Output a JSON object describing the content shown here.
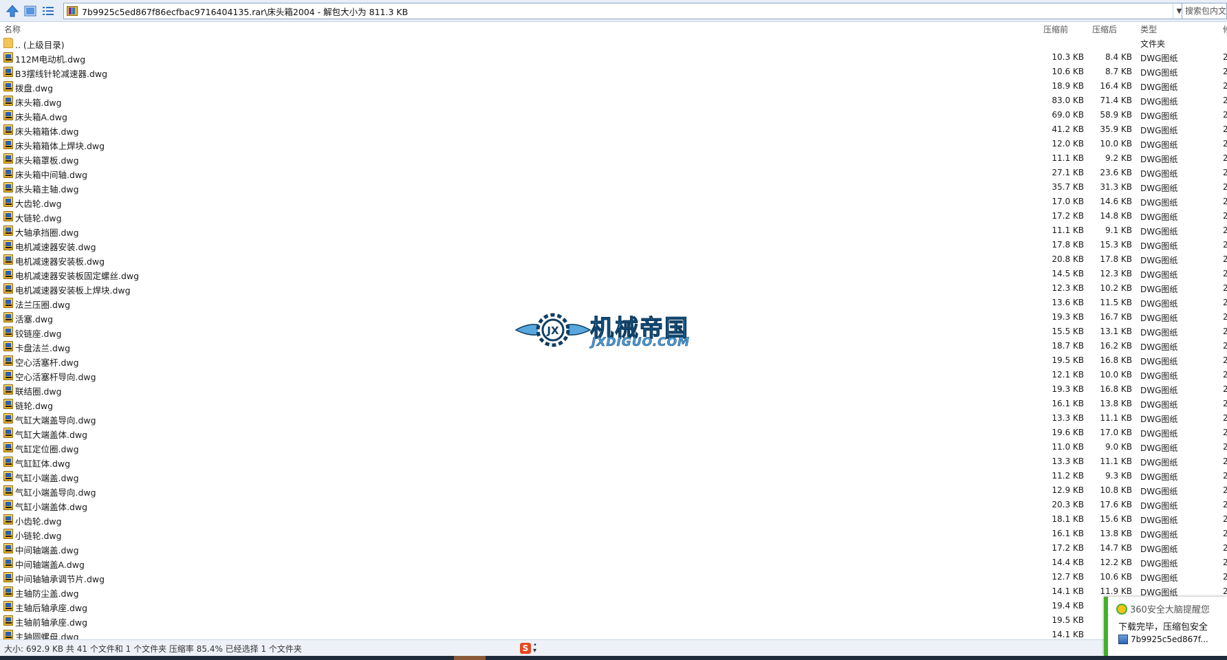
{
  "toolbar": {
    "up_icon": "up-arrow-icon",
    "view_icon": "panel-view-icon",
    "details_icon": "details-list-icon"
  },
  "address": {
    "path": "7b9925c5ed867f86ecfbac9716404135.rar\\床头箱2004 - 解包大小为 811.3 KB"
  },
  "search": {
    "placeholder": "搜索包内文件"
  },
  "columns": {
    "name": "名称",
    "packed": "压缩前",
    "unpacked": "压缩后",
    "type": "类型",
    "extra": "修"
  },
  "parent_folder": {
    "name": ".. (上级目录)",
    "type": "文件夹"
  },
  "files": [
    {
      "name": "112M电动机.dwg",
      "before": "10.3 KB",
      "after": "8.4 KB",
      "type": "DWG图纸",
      "extra": "2"
    },
    {
      "name": "B3摆线针轮减速器.dwg",
      "before": "10.6 KB",
      "after": "8.7 KB",
      "type": "DWG图纸",
      "extra": "2"
    },
    {
      "name": "拨盘.dwg",
      "before": "18.9 KB",
      "after": "16.4 KB",
      "type": "DWG图纸",
      "extra": "2"
    },
    {
      "name": "床头箱.dwg",
      "before": "83.0 KB",
      "after": "71.4 KB",
      "type": "DWG图纸",
      "extra": "2"
    },
    {
      "name": "床头箱A.dwg",
      "before": "69.0 KB",
      "after": "58.9 KB",
      "type": "DWG图纸",
      "extra": "2"
    },
    {
      "name": "床头箱箱体.dwg",
      "before": "41.2 KB",
      "after": "35.9 KB",
      "type": "DWG图纸",
      "extra": "2"
    },
    {
      "name": "床头箱箱体上焊块.dwg",
      "before": "12.0 KB",
      "after": "10.0 KB",
      "type": "DWG图纸",
      "extra": "2"
    },
    {
      "name": "床头箱罩板.dwg",
      "before": "11.1 KB",
      "after": "9.2 KB",
      "type": "DWG图纸",
      "extra": "2"
    },
    {
      "name": "床头箱中间轴.dwg",
      "before": "27.1 KB",
      "after": "23.6 KB",
      "type": "DWG图纸",
      "extra": "2"
    },
    {
      "name": "床头箱主轴.dwg",
      "before": "35.7 KB",
      "after": "31.3 KB",
      "type": "DWG图纸",
      "extra": "2"
    },
    {
      "name": "大齿轮.dwg",
      "before": "17.0 KB",
      "after": "14.6 KB",
      "type": "DWG图纸",
      "extra": "2"
    },
    {
      "name": "大链轮.dwg",
      "before": "17.2 KB",
      "after": "14.8 KB",
      "type": "DWG图纸",
      "extra": "2"
    },
    {
      "name": "大轴承挡圈.dwg",
      "before": "11.1 KB",
      "after": "9.1 KB",
      "type": "DWG图纸",
      "extra": "2"
    },
    {
      "name": "电机减速器安装.dwg",
      "before": "17.8 KB",
      "after": "15.3 KB",
      "type": "DWG图纸",
      "extra": "2"
    },
    {
      "name": "电机减速器安装板.dwg",
      "before": "20.8 KB",
      "after": "17.8 KB",
      "type": "DWG图纸",
      "extra": "2"
    },
    {
      "name": "电机减速器安装板固定螺丝.dwg",
      "before": "14.5 KB",
      "after": "12.3 KB",
      "type": "DWG图纸",
      "extra": "2"
    },
    {
      "name": "电机减速器安装板上焊块.dwg",
      "before": "12.3 KB",
      "after": "10.2 KB",
      "type": "DWG图纸",
      "extra": "2"
    },
    {
      "name": "法兰压圈.dwg",
      "before": "13.6 KB",
      "after": "11.5 KB",
      "type": "DWG图纸",
      "extra": "2"
    },
    {
      "name": "活塞.dwg",
      "before": "19.3 KB",
      "after": "16.7 KB",
      "type": "DWG图纸",
      "extra": "2"
    },
    {
      "name": "铰链座.dwg",
      "before": "15.5 KB",
      "after": "13.1 KB",
      "type": "DWG图纸",
      "extra": "2"
    },
    {
      "name": "卡盘法兰.dwg",
      "before": "18.7 KB",
      "after": "16.2 KB",
      "type": "DWG图纸",
      "extra": "2"
    },
    {
      "name": "空心活塞杆.dwg",
      "before": "19.5 KB",
      "after": "16.8 KB",
      "type": "DWG图纸",
      "extra": "2"
    },
    {
      "name": "空心活塞杆导向.dwg",
      "before": "12.1 KB",
      "after": "10.0 KB",
      "type": "DWG图纸",
      "extra": "2"
    },
    {
      "name": "联结圈.dwg",
      "before": "19.3 KB",
      "after": "16.8 KB",
      "type": "DWG图纸",
      "extra": "2"
    },
    {
      "name": "链轮.dwg",
      "before": "16.1 KB",
      "after": "13.8 KB",
      "type": "DWG图纸",
      "extra": "2"
    },
    {
      "name": "气缸大端盖导向.dwg",
      "before": "13.3 KB",
      "after": "11.1 KB",
      "type": "DWG图纸",
      "extra": "2"
    },
    {
      "name": "气缸大端盖体.dwg",
      "before": "19.6 KB",
      "after": "17.0 KB",
      "type": "DWG图纸",
      "extra": "2"
    },
    {
      "name": "气缸定位圈.dwg",
      "before": "11.0 KB",
      "after": "9.0 KB",
      "type": "DWG图纸",
      "extra": "2"
    },
    {
      "name": "气缸缸体.dwg",
      "before": "13.3 KB",
      "after": "11.1 KB",
      "type": "DWG图纸",
      "extra": "2"
    },
    {
      "name": "气缸小端盖.dwg",
      "before": "11.2 KB",
      "after": "9.3 KB",
      "type": "DWG图纸",
      "extra": "2"
    },
    {
      "name": "气缸小端盖导向.dwg",
      "before": "12.9 KB",
      "after": "10.8 KB",
      "type": "DWG图纸",
      "extra": "2"
    },
    {
      "name": "气缸小端盖体.dwg",
      "before": "20.3 KB",
      "after": "17.6 KB",
      "type": "DWG图纸",
      "extra": "2"
    },
    {
      "name": "小齿轮.dwg",
      "before": "18.1 KB",
      "after": "15.6 KB",
      "type": "DWG图纸",
      "extra": "2"
    },
    {
      "name": "小链轮.dwg",
      "before": "16.1 KB",
      "after": "13.8 KB",
      "type": "DWG图纸",
      "extra": "2"
    },
    {
      "name": "中间轴端盖.dwg",
      "before": "17.2 KB",
      "after": "14.7 KB",
      "type": "DWG图纸",
      "extra": "2"
    },
    {
      "name": "中间轴端盖A.dwg",
      "before": "14.4 KB",
      "after": "12.2 KB",
      "type": "DWG图纸",
      "extra": "2"
    },
    {
      "name": "中间轴轴承调节片.dwg",
      "before": "12.7 KB",
      "after": "10.6 KB",
      "type": "DWG图纸",
      "extra": "2"
    },
    {
      "name": "主轴防尘盖.dwg",
      "before": "14.1 KB",
      "after": "11.9 KB",
      "type": "DWG图纸",
      "extra": "2"
    },
    {
      "name": "主轴后轴承座.dwg",
      "before": "19.4 KB",
      "after": "",
      "type": "",
      "extra": ""
    },
    {
      "name": "主轴前轴承座.dwg",
      "before": "19.5 KB",
      "after": "",
      "type": "",
      "extra": ""
    },
    {
      "name": "主轴圆螺母.dwg",
      "before": "14.1 KB",
      "after": "",
      "type": "",
      "extra": ""
    }
  ],
  "watermark": {
    "title": "机械帝国",
    "subtitle": "JXDIGUO.COM",
    "emblem_text": "JX"
  },
  "status": {
    "text": "大小: 692.9 KB 共 41 个文件和 1 个文件夹 压缩率 85.4% 已经选择 1 个文件夹"
  },
  "ime": {
    "logo": "S"
  },
  "toast": {
    "title": "360安全大脑提醒您",
    "message": "下载完毕，压缩包安全",
    "file": "7b9925c5ed867f..."
  }
}
